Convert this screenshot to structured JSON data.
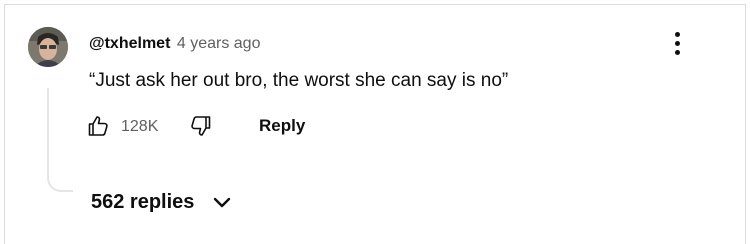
{
  "comment": {
    "author": "@txhelmet",
    "timestamp": "4 years ago",
    "text": "“Just ask her out bro, the worst she can say is no”",
    "like_count": "128K",
    "reply_label": "Reply",
    "replies_label": "562 replies"
  },
  "icons": {
    "like": "thumbs-up-outline-icon",
    "dislike": "thumbs-down-outline-icon",
    "menu": "vertical-dots-icon",
    "expand": "chevron-down-icon"
  },
  "colors": {
    "primary_text": "#0f0f0f",
    "secondary_text": "#606060",
    "thread_line": "#e5e5e5"
  }
}
